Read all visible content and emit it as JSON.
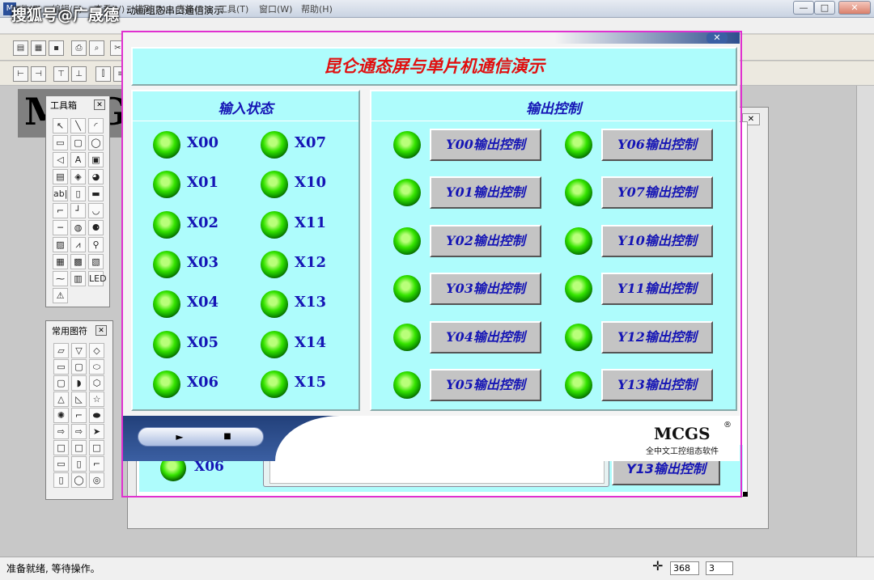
{
  "watermark": "搜狐号@广晟德",
  "app": {
    "icon_label": "M",
    "title": "动画组态串口通信演示",
    "window_buttons": {
      "minimize": "—",
      "restore": "□",
      "close": "✕"
    }
  },
  "menu": {
    "items": [
      "文件(F)",
      "编辑(E)",
      "查看(V)",
      "排列(D)",
      "表格(B)",
      "工具(T)",
      "窗口(W)",
      "帮助(H)"
    ]
  },
  "workspace": {
    "logo_text": "MCGS"
  },
  "toolbox": {
    "title": "工具箱",
    "close": "✕",
    "tools": [
      "↖",
      "╲",
      "◜",
      "▭",
      "▢",
      "◯",
      "◁",
      "A",
      "▣",
      "▤",
      "◈",
      "◕",
      "ab|",
      "▯",
      "▬",
      "⌐",
      "┘",
      "◡",
      "─",
      "◍",
      "⚈",
      "▨",
      "⩘",
      "⚲",
      "▦",
      "▩",
      "▧",
      "⁓",
      "▥",
      "LED",
      "⚠"
    ]
  },
  "shapes_panel": {
    "title": "常用图符",
    "close": "✕",
    "shapes": [
      "▱",
      "▽",
      "◇",
      "▭",
      "▢",
      "⬭",
      "▢",
      "◗",
      "⬡",
      "△",
      "◺",
      "☆",
      "✺",
      "⌐",
      "⬬",
      "⇨",
      "⇨",
      "➤",
      "□",
      "□",
      "□",
      "▭",
      "▯",
      "⌐",
      "▯",
      "◯",
      "◎"
    ]
  },
  "dialog": {
    "close": "✕",
    "title": "昆仑通态屏与单片机通信演示",
    "input_section": {
      "title": "输入状态",
      "left_labels": [
        "X00",
        "X01",
        "X02",
        "X03",
        "X04",
        "X05",
        "X06"
      ],
      "right_labels": [
        "X07",
        "X10",
        "X11",
        "X12",
        "X13",
        "X14",
        "X15"
      ]
    },
    "output_section": {
      "title": "输出控制",
      "left_buttons": [
        "Y00输出控制",
        "Y01输出控制",
        "Y02输出控制",
        "Y03输出控制",
        "Y04输出控制",
        "Y05输出控制"
      ],
      "right_buttons": [
        "Y06输出控制",
        "Y07输出控制",
        "Y10输出控制",
        "Y11输出控制",
        "Y12输出控制",
        "Y13输出控制"
      ]
    },
    "brand": {
      "name": "MCGS",
      "registered": "®",
      "subtitle": "全中文工控组态软件",
      "play": "►",
      "stop": "■"
    }
  },
  "background_window": {
    "close": "✕",
    "led_label": "X06",
    "button_label": "Y13输出控制"
  },
  "status": {
    "text": "准备就绪, 等待操作。",
    "cursor_symbol": "✛",
    "x_value": "368",
    "y_value": "3"
  },
  "colors": {
    "panel_cyan": "#aefcfc",
    "title_red": "#e01010",
    "label_blue": "#1515b5",
    "led_green": "#35e400",
    "frame_magenta": "#e030d0"
  }
}
